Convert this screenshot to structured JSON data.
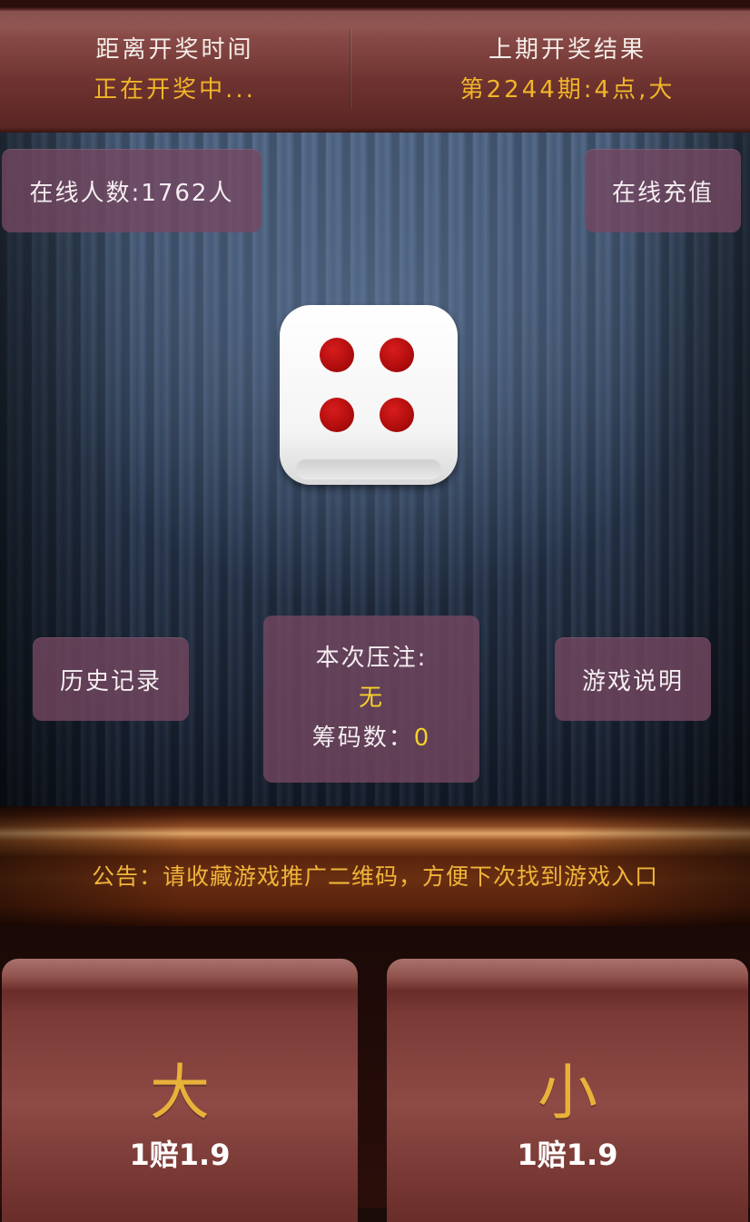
{
  "header": {
    "left_label": "距离开奖时间",
    "left_value": "正在开奖中...",
    "right_label": "上期开奖结果",
    "right_value": "第2244期:4点,大"
  },
  "table": {
    "online_label": "在线人数:1762人",
    "recharge_label": "在线充值",
    "history_label": "历史记录",
    "rules_label": "游戏说明",
    "dice": {
      "value": 4,
      "icon": "dice-four-icon"
    },
    "current_bet": {
      "title": "本次压注:",
      "value": "无",
      "chips_label": "筹码数：",
      "chips_value": "0"
    }
  },
  "notice": "公告：请收藏游戏推广二维码，方便下次找到游戏入口",
  "bets": [
    {
      "label": "大",
      "odds": "1赔1.9"
    },
    {
      "label": "小",
      "odds": "1赔1.9"
    }
  ],
  "colors": {
    "accent_gold": "#f1b52a",
    "bet_yellow": "#f4d02a",
    "panel": "#764862",
    "pip_red": "#c41414"
  }
}
